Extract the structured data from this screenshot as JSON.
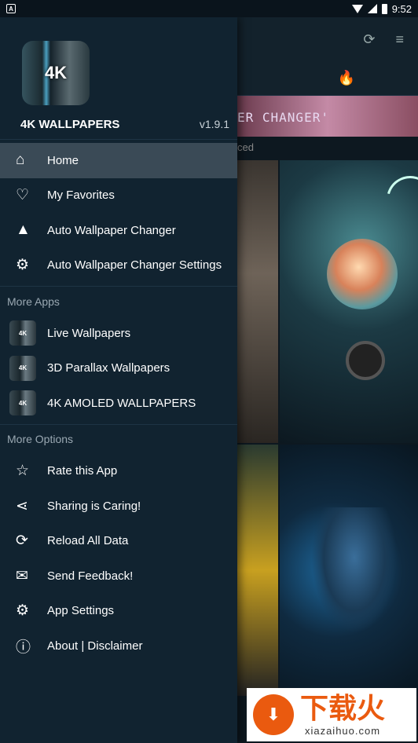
{
  "status_bar": {
    "time": "9:52",
    "left_icon": "A"
  },
  "background_app": {
    "toolbar_icons": [
      "refresh-icon",
      "sort-icon"
    ],
    "tab_icon": "fire-icon",
    "banner_text": "ER CHANGER'",
    "sub_text": "ced"
  },
  "drawer": {
    "app_logo_text": "4K",
    "app_name": "4K WALLPAPERS",
    "version": "v1.9.1",
    "main_items": [
      {
        "label": "Home",
        "icon": "home-icon",
        "glyph": "⌂",
        "active": true
      },
      {
        "label": "My Favorites",
        "icon": "heart-icon",
        "glyph": "♡"
      },
      {
        "label": "Auto Wallpaper Changer",
        "icon": "mountain-icon",
        "glyph": "▲"
      },
      {
        "label": "Auto Wallpaper Changer Settings",
        "icon": "gear-icon",
        "glyph": "⚙"
      }
    ],
    "more_apps_title": "More Apps",
    "more_apps": [
      {
        "label": "Live Wallpapers",
        "thumb": "4K"
      },
      {
        "label": "3D Parallax Wallpapers",
        "thumb": "4K"
      },
      {
        "label": "4K AMOLED WALLPAPERS",
        "thumb": "4K"
      }
    ],
    "more_options_title": "More Options",
    "more_options": [
      {
        "label": "Rate this App",
        "icon": "star-icon",
        "glyph": "☆"
      },
      {
        "label": "Sharing is Caring!",
        "icon": "share-icon",
        "glyph": "⋖"
      },
      {
        "label": "Reload All Data",
        "icon": "reload-icon",
        "glyph": "⟳"
      },
      {
        "label": "Send Feedback!",
        "icon": "feedback-icon",
        "glyph": "✉"
      },
      {
        "label": "App Settings",
        "icon": "gear-icon",
        "glyph": "⚙"
      },
      {
        "label": "About | Disclaimer",
        "icon": "info-icon",
        "glyph": "ⓘ"
      }
    ]
  },
  "watermark": {
    "cn": "下载火",
    "url": "xiazaihuo.com"
  }
}
